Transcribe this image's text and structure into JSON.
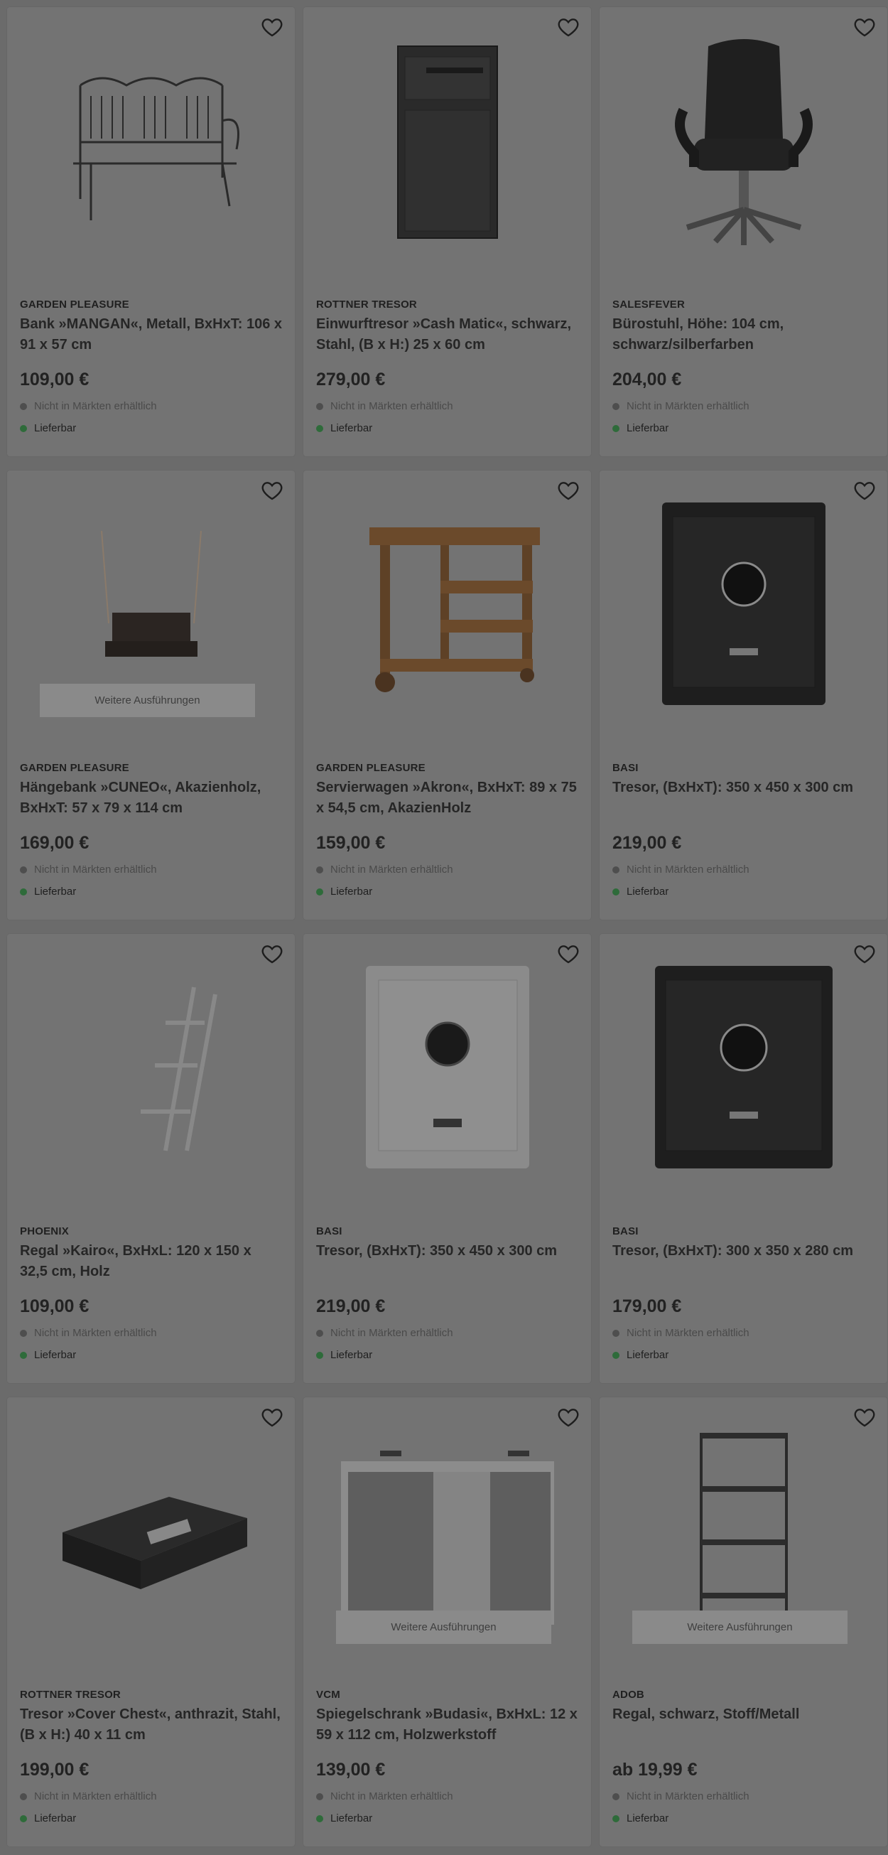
{
  "labels": {
    "not_in_stores": "Nicht in Märkten erhältlich",
    "deliverable": "Lieferbar",
    "more_versions": "Weitere Ausführungen"
  },
  "colors": {
    "overlay_background": "#6b6b6b",
    "card_background": "#737373",
    "deliverable_dot": "#2e6b3a"
  },
  "products": [
    {
      "brand": "GARDEN PLEASURE",
      "title": "Bank »MANGAN«, Metall, BxHxT: 106 x 91 x 57 cm",
      "price": "109,00 €",
      "image": "metal-garden-bench-image",
      "more": false
    },
    {
      "brand": "ROTTNER TRESOR",
      "title": "Einwurftresor »Cash Matic«, schwarz, Stahl, (B x H:) 25 x 60 cm",
      "price": "279,00 €",
      "image": "deposit-safe-image",
      "more": false
    },
    {
      "brand": "SALESFEVER",
      "title": "Bürostuhl, Höhe: 104 cm, schwarz/silberfarben",
      "price": "204,00 €",
      "image": "office-chair-image",
      "more": false
    },
    {
      "brand": "GARDEN PLEASURE",
      "title": "Hängebank »CUNEO«, Akazienholz, BxHxT: 57 x 79 x 114 cm",
      "price": "169,00 €",
      "image": "hanging-bench-image",
      "more": true
    },
    {
      "brand": "GARDEN PLEASURE",
      "title": "Servierwagen »Akron«, BxHxT: 89 x 75 x 54,5 cm, AkazienHolz",
      "price": "159,00 €",
      "image": "serving-cart-image",
      "more": false
    },
    {
      "brand": "BASI",
      "title": "Tresor, (BxHxT): 350 x 450 x 300 cm",
      "price": "219,00 €",
      "image": "black-safe-image",
      "more": false
    },
    {
      "brand": "PHOENIX",
      "title": "Regal »Kairo«, BxHxL: 120 x 150 x 32,5 cm, Holz",
      "price": "109,00 €",
      "image": "ladder-shelf-image",
      "more": false
    },
    {
      "brand": "BASI",
      "title": "Tresor, (BxHxT): 350 x 450 x 300 cm",
      "price": "219,00 €",
      "image": "white-safe-image",
      "more": false
    },
    {
      "brand": "BASI",
      "title": "Tresor, (BxHxT): 300 x 350 x 280 cm",
      "price": "179,00 €",
      "image": "black-safe-image",
      "more": false
    },
    {
      "brand": "ROTTNER TRESOR",
      "title": "Tresor »Cover Chest«, anthrazit, Stahl, (B x H:) 40 x 11 cm",
      "price": "199,00 €",
      "image": "flat-safe-image",
      "more": false
    },
    {
      "brand": "VCM",
      "title": "Spiegelschrank »Budasi«, BxHxL: 12 x 59 x 112 cm, Holzwerkstoff",
      "price": "139,00 €",
      "image": "mirror-cabinet-image",
      "more": true
    },
    {
      "brand": "ADOB",
      "title": "Regal, schwarz, Stoff/Metall",
      "price": "ab 19,99 €",
      "image": "metal-shelf-image",
      "more": true
    }
  ]
}
